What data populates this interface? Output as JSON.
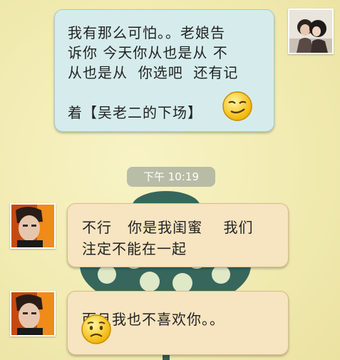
{
  "messages": [
    {
      "sender": "me",
      "text": "我有那么可怕。。老娘告\n诉你 今天你从也是从 不\n从也是从  你选吧  还有记\n\n着【吴老二的下场】",
      "emoji": "smirk-emoji"
    },
    {
      "sender": "friend",
      "text": "不行   你是我闺蜜    我们\n注定不能在一起"
    },
    {
      "sender": "friend",
      "text": "而且我也不喜欢你。。",
      "emoji": "worried-emoji"
    }
  ],
  "timestamp": "下午 10:19",
  "colors": {
    "my_bubble": "#d6ecec",
    "friend_bubble": "#f7e4c0",
    "wallpaper": "#f2ecb0"
  }
}
